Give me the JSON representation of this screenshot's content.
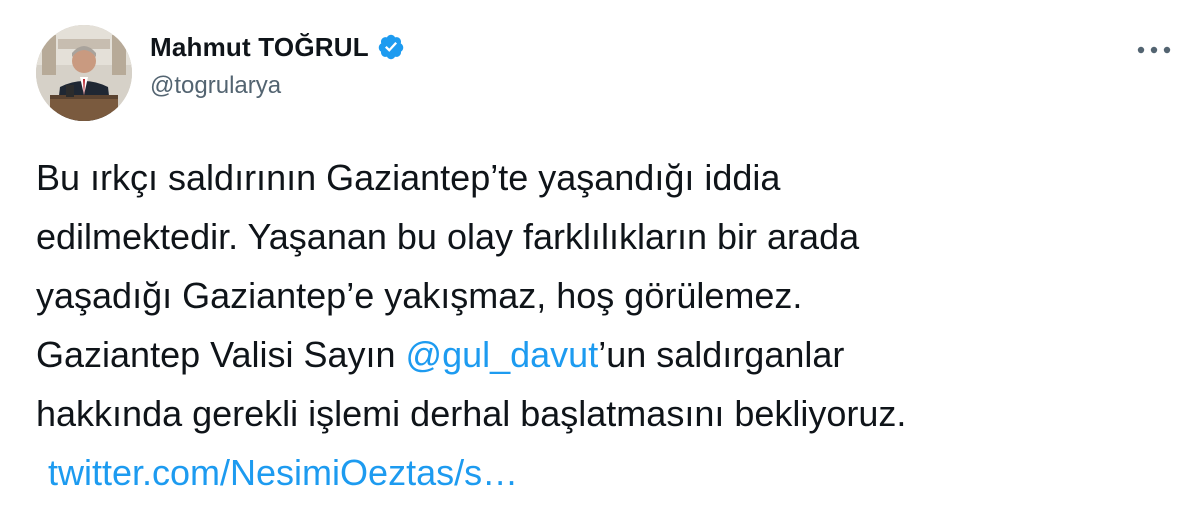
{
  "author": {
    "display_name": "Mahmut TOĞRUL",
    "handle": "@togrularya",
    "verified_icon": "verified-badge-icon",
    "avatar_icon": "avatar-photo"
  },
  "menu": {
    "more_icon": "more-horizontal-icon"
  },
  "tweet": {
    "line1": "Bu ırkçı saldırının Gaziantep’te yaşandığı iddia",
    "line2": "edilmektedir. Yaşanan bu olay farklılıkların bir arada",
    "line3": "yaşadığı Gaziantep’e yakışmaz, hoş görülemez.",
    "line4_prefix": "Gaziantep Valisi Sayın ",
    "mention": "@gul_davut",
    "line4_suffix": "’un saldırganlar",
    "line5": "hakkında gerekli işlemi derhal başlatmasını bekliyoruz.",
    "link": "twitter.com/NesimiOeztas/s…"
  },
  "colors": {
    "link": "#1d9bf0",
    "text": "#0f1419",
    "secondary": "#536471",
    "background": "#ffffff"
  }
}
